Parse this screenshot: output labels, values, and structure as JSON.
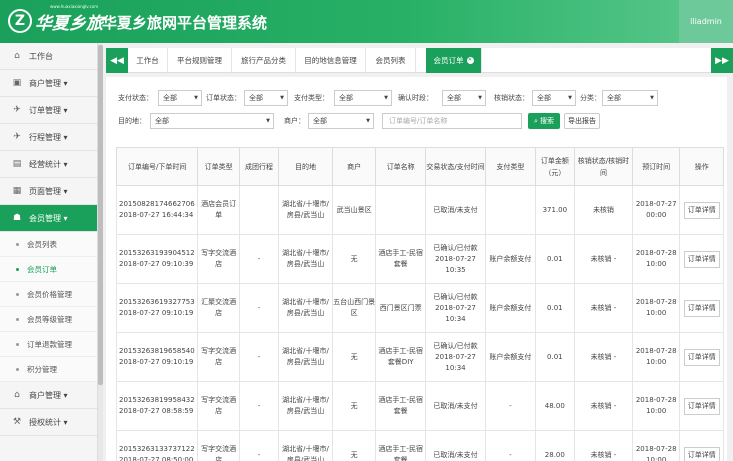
{
  "app": {
    "logo_mark": "Z",
    "logo_text": "华夏乡旅",
    "logo_sub": "www.huaxiaxianglv.com",
    "title": "华夏乡旅网平台管理系统",
    "user": "lliadmin"
  },
  "sidebar": {
    "items": [
      {
        "label": "工作台",
        "icon": "home-icon"
      },
      {
        "label": "商户管理 ▾",
        "icon": "shop-icon"
      },
      {
        "label": "订单管理 ▾",
        "icon": "plane-icon"
      },
      {
        "label": "行程管理 ▾",
        "icon": "route-icon"
      },
      {
        "label": "经营统计 ▾",
        "icon": "chart-icon"
      },
      {
        "label": "页面管理 ▾",
        "icon": "page-icon"
      },
      {
        "label": "会员管理 ▾",
        "icon": "users-icon"
      }
    ],
    "sub_items": [
      {
        "label": "会员列表"
      },
      {
        "label": "会员订单"
      },
      {
        "label": "会员价格管理"
      },
      {
        "label": "会员等级管理"
      },
      {
        "label": "订单退款管理"
      },
      {
        "label": "积分管理"
      }
    ],
    "bottom_items": [
      {
        "label": "商户管理 ▾",
        "icon": "bank-icon"
      },
      {
        "label": "授权统计 ▾",
        "icon": "gavel-icon"
      }
    ]
  },
  "tabs": [
    {
      "label": "工作台"
    },
    {
      "label": "平台规则管理"
    },
    {
      "label": "旅行产品分类"
    },
    {
      "label": "目的地信息管理"
    },
    {
      "label": "会员列表"
    },
    {
      "label": "会员订单"
    }
  ],
  "filters": {
    "row1": [
      {
        "label": "支付状态：",
        "value": "全部"
      },
      {
        "label": "订单状态：",
        "value": "全部"
      },
      {
        "label": "支付类型：",
        "value": "全部"
      },
      {
        "label": "确认时段：",
        "value": "全部"
      },
      {
        "label": "核销状态：",
        "value": "全部"
      },
      {
        "label": "分类：",
        "value": "全部"
      }
    ],
    "row2": [
      {
        "label": "目的地：",
        "value": "全部"
      },
      {
        "label": "商户：",
        "value": "全部"
      }
    ],
    "search_placeholder": "订单编号/订单名称",
    "search_btn": "搜索",
    "report_btn": "导出报告"
  },
  "table": {
    "headers": [
      "订单编号/下单时间",
      "订单类型",
      "成团行程",
      "目的地",
      "商户",
      "订单名称",
      "交易状态/支付时间",
      "支付类型",
      "订单金额（元）",
      "核销状态/核销时间",
      "预订时间",
      "操作"
    ],
    "rows": [
      {
        "no": "20150828174662706",
        "time": "2018-07-27 16:44:34",
        "type": "酒店会员订单",
        "group": "",
        "dest": "湖北省/十堰市/房县/武当山",
        "merchant": "武当山景区",
        "name": "",
        "status": "已取消/未支付",
        "pay": "",
        "amount": "371.00",
        "verify": "未核销",
        "book": "2018-07-27 00:00",
        "op": "订单详情"
      },
      {
        "no": "20153263193904512",
        "time": "2018-07-27 09:10:39",
        "type": "写字交流酒店",
        "group": "-",
        "dest": "湖北省/十堰市/房县/武当山",
        "merchant": "无",
        "name": "酒店手工-民宿套餐",
        "status": "已确认/已付款 2018-07-27 10:35",
        "pay": "账户余额支付",
        "amount": "0.01",
        "verify": "未核销 -",
        "book": "2018-07-28 10:00",
        "op": "订单详情"
      },
      {
        "no": "20153263619327753",
        "time": "2018-07-27 09:10:19",
        "type": "汇聚交流酒店",
        "group": "-",
        "dest": "湖北省/十堰市/房县/武当山",
        "merchant": "五台山西门景区",
        "name": "西门景区门票",
        "status": "已确认/已付款 2018-07-27 10:34",
        "pay": "账户余额支付",
        "amount": "0.01",
        "verify": "未核销 -",
        "book": "2018-07-28 10:00",
        "op": "订单详情"
      },
      {
        "no": "20153263819658540",
        "time": "2018-07-27 09:10:19",
        "type": "写字交流酒店",
        "group": "-",
        "dest": "湖北省/十堰市/房县/武当山",
        "merchant": "无",
        "name": "酒店手工-民宿套餐DIY",
        "status": "已确认/已付款 2018-07-27 10:34",
        "pay": "账户余额支付",
        "amount": "0.01",
        "verify": "未核销 -",
        "book": "2018-07-28 10:00",
        "op": "订单详情"
      },
      {
        "no": "20153263819958432",
        "time": "2018-07-27 08:58:59",
        "type": "写字交流酒店",
        "group": "-",
        "dest": "湖北省/十堰市/房县/武当山",
        "merchant": "无",
        "name": "酒店手工-民宿套餐",
        "status": "已取消/未支付",
        "pay": "-",
        "amount": "48.00",
        "verify": "未核销 -",
        "book": "2018-07-28 10:00",
        "op": "订单详情"
      },
      {
        "no": "20153263133737122",
        "time": "2018-07-27 08:50:00",
        "type": "写字交流酒店",
        "group": "-",
        "dest": "湖北省/十堰市/房县/武当山",
        "merchant": "无",
        "name": "酒店手工-民宿套餐",
        "status": "已取消/未支付",
        "pay": "-",
        "amount": "28.00",
        "verify": "未核销 -",
        "book": "2018-07-28 10:00",
        "op": "订单详情"
      }
    ]
  },
  "colors": {
    "primary": "#1aa05a",
    "topbar_end": "#5cc98d"
  }
}
